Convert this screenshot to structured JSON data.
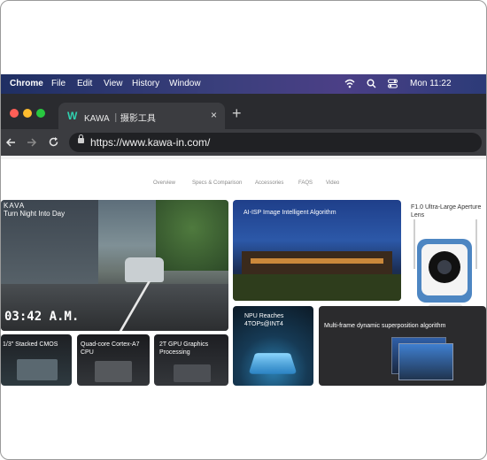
{
  "menubar": {
    "app": "Chrome",
    "menus": [
      "File",
      "Edit",
      "View",
      "History",
      "Window"
    ],
    "clock": "Mon 11:22"
  },
  "tab": {
    "title": "KAWA ｜摄影工具",
    "close": "×",
    "new": "+"
  },
  "address": {
    "url": "https://www.kawa-in.com/"
  },
  "subnav": [
    "Overview",
    "Specs & Comparison",
    "Accessories",
    "FAQS",
    "Video"
  ],
  "hero": {
    "brand": "KAVA",
    "headline": "Turn Night Into Day",
    "time": "03:42 A.M."
  },
  "tiles": {
    "ai_isp": "AI-ISP Image Intelligent Algorithm",
    "aperture": "F1.0 Ultra-Large Aperture Lens",
    "npu": "NPU Reaches 4TOPs@INT4",
    "multiframe": "Multi-frame dynamic superposition algorithm",
    "cmos": "1/3\" Stacked CMOS",
    "cpu": "Quad-core Cortex-A7 CPU",
    "gpu": "2T GPU Graphics Processing"
  }
}
